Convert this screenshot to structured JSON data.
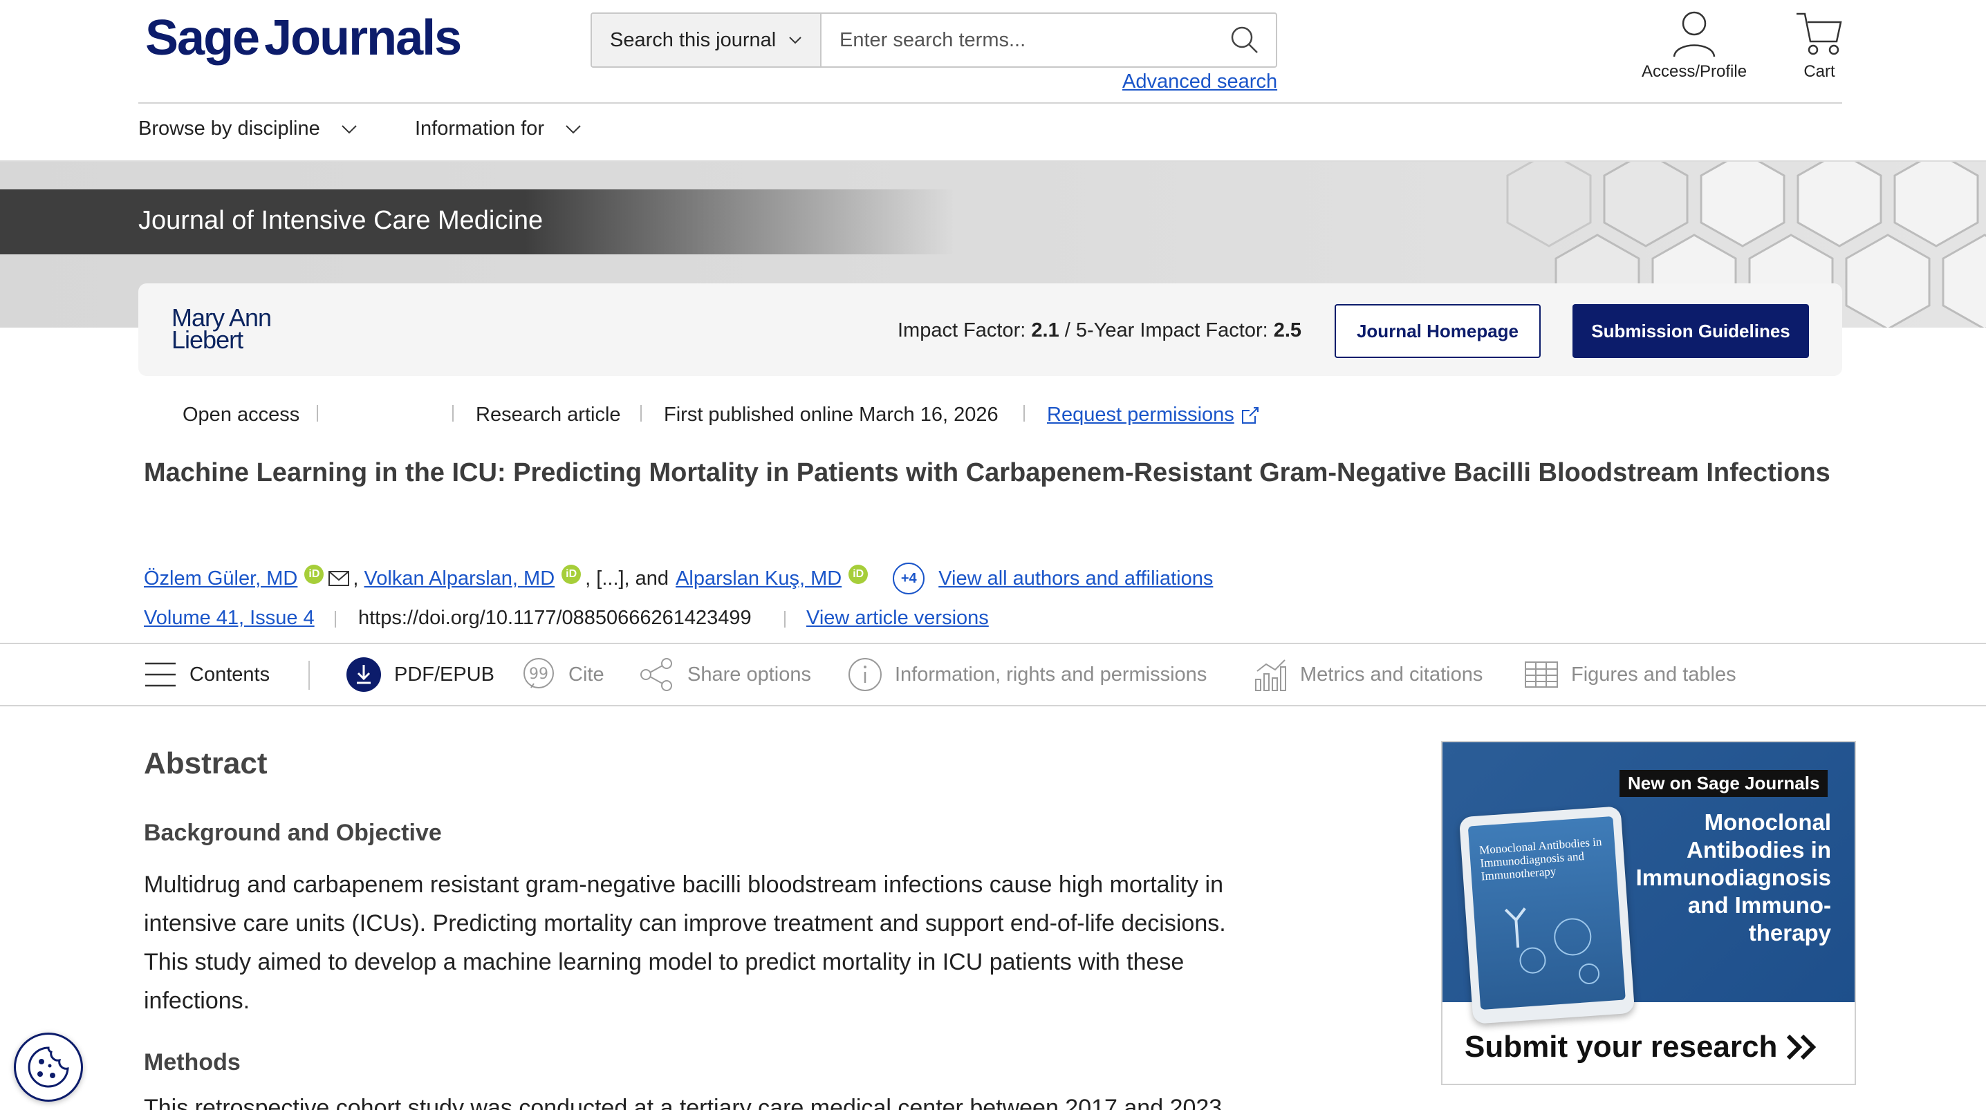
{
  "header": {
    "logo_sage": "Sage",
    "logo_journals": "Journals",
    "search_scope": "Search this journal",
    "search_placeholder": "Enter search terms...",
    "advanced_search": "Advanced search",
    "access_label": "Access/Profile",
    "cart_label": "Cart"
  },
  "nav": {
    "browse": "Browse by discipline",
    "info": "Information for"
  },
  "journal": {
    "title": "Journal of Intensive Care Medicine",
    "publisher_line1": "Mary Ann",
    "publisher_line2": "Liebert",
    "impact_label": "Impact Factor:",
    "impact_value": "2.1",
    "five_year_label": "/ 5-Year Impact Factor:",
    "five_year_value": "2.5",
    "homepage_button": "Journal Homepage",
    "guidelines_button": "Submission Guidelines"
  },
  "article": {
    "access": "Open access",
    "type": "Research article",
    "published": "First published online March 16, 2026",
    "permissions": "Request permissions",
    "title": "Machine Learning in the ICU: Predicting Mortality in Patients with Carbapenem-Resistant Gram-Negative Bacilli Bloodstream Infections",
    "author1": "Özlem Güler, MD",
    "author2": "Volkan Alparslan, MD",
    "ellipsis": ", [...], and",
    "author3": "Alparslan Kuş, MD",
    "more_authors": "+4",
    "view_authors": "View all authors and affiliations",
    "volume": "Volume 41, Issue 4",
    "doi": "https://doi.org/10.1177/08850666261423499",
    "versions": "View article versions"
  },
  "toolbar": {
    "contents": "Contents",
    "pdf": "PDF/EPUB",
    "cite": "Cite",
    "share": "Share options",
    "info": "Information, rights and permissions",
    "metrics": "Metrics and citations",
    "figures": "Figures and tables"
  },
  "abstract": {
    "heading": "Abstract",
    "bg_heading": "Background and Objective",
    "bg_text": "Multidrug and carbapenem resistant gram-negative bacilli bloodstream infections cause high mortality in intensive care units (ICUs). Predicting mortality can improve treatment and support end-of-life decisions. This study aimed to develop a machine learning model to predict mortality in ICU patients with these infections.",
    "methods_heading": "Methods",
    "methods_text": "This retrospective cohort study was conducted at a tertiary care medical center between 2017 and 2023"
  },
  "ad": {
    "badge": "New on Sage Journals",
    "title": "Monoclonal Antibodies in Immunodiagnosis and Immuno-therapy",
    "tablet_title": "Monoclonal Antibodies in Immunodiagnosis and Immunotherapy",
    "cta": "Submit your research"
  },
  "colors": {
    "brand": "#0c1c6b",
    "link": "#1a55c9",
    "orcid": "#a6ce39",
    "ad_blue": "#1e4f8b"
  }
}
